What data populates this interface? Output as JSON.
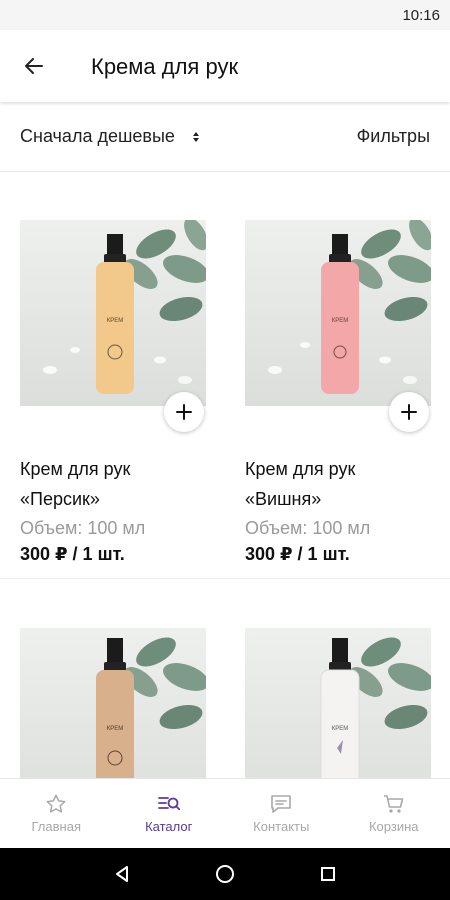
{
  "status_bar": {
    "time": "10:16"
  },
  "header": {
    "title": "Крема для рук",
    "back_icon": "arrow-left-icon"
  },
  "sort_bar": {
    "sort_label": "Сначала дешевые",
    "filter_label": "Фильтры"
  },
  "products": [
    {
      "name": "Крем для рук «Персик»",
      "volume": "Объем: 100 мл",
      "price": "300 ₽ / 1 шт.",
      "bottle_color": "#f2c98a"
    },
    {
      "name": "Крем для рук «Вишня»",
      "volume": "Объем: 100 мл",
      "price": "300 ₽ / 1 шт.",
      "bottle_color": "#f3a7a8"
    },
    {
      "name": "",
      "volume": "",
      "price": "",
      "bottle_color": "#d9b08c"
    },
    {
      "name": "",
      "volume": "",
      "price": "",
      "bottle_color": "#f4f3f1"
    }
  ],
  "bottom_nav": [
    {
      "label": "Главная",
      "icon": "star-icon",
      "active": false
    },
    {
      "label": "Каталог",
      "icon": "catalog-search-icon",
      "active": true
    },
    {
      "label": "Контакты",
      "icon": "chat-icon",
      "active": false
    },
    {
      "label": "Корзина",
      "icon": "cart-icon",
      "active": false
    }
  ],
  "colors": {
    "accent": "#5a3b9c",
    "inactive": "#a8a8a8"
  }
}
